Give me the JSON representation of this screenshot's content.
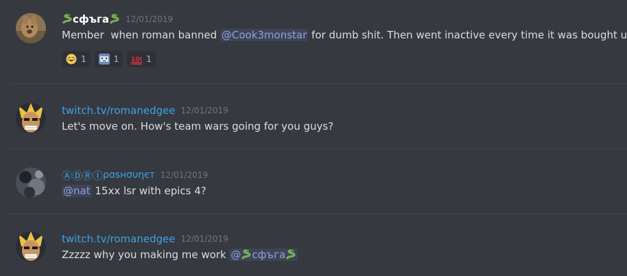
{
  "messages": [
    {
      "username": "сфъга",
      "timestamp": "12/01/2019",
      "text_before": "Member  when roman banned ",
      "mention": "@Cook3monstar",
      "text_after": " for dumb shit. Then went inactive every time it was bought up",
      "reactions": [
        {
          "emoji": "joy-emoji",
          "count": "1"
        },
        {
          "emoji": "face-emoji",
          "count": "1"
        },
        {
          "emoji": "hundred-emoji",
          "count": "1"
        }
      ]
    },
    {
      "username": "twitch.tv/romanedgee",
      "timestamp": "12/01/2019",
      "text": "Let's move on. How's team wars going for you guys?"
    },
    {
      "username": "ⒶⒹⓇⒾ",
      "username_suffix": "ρɑsнσυηєт",
      "timestamp": "12/01/2019",
      "mention": "@nat",
      "text": " 15xx lsr with epics 4?"
    },
    {
      "username": "twitch.tv/romanedgee",
      "timestamp": "12/01/2019",
      "text": "Zzzzz why you making me work ",
      "mention_prefix": "@",
      "mention_name": "сфъга"
    }
  ],
  "colors": {
    "background": "#36393f",
    "mention": "#8ea1e1",
    "link_user": "#3ea2e6",
    "timestamp": "#72767d"
  }
}
